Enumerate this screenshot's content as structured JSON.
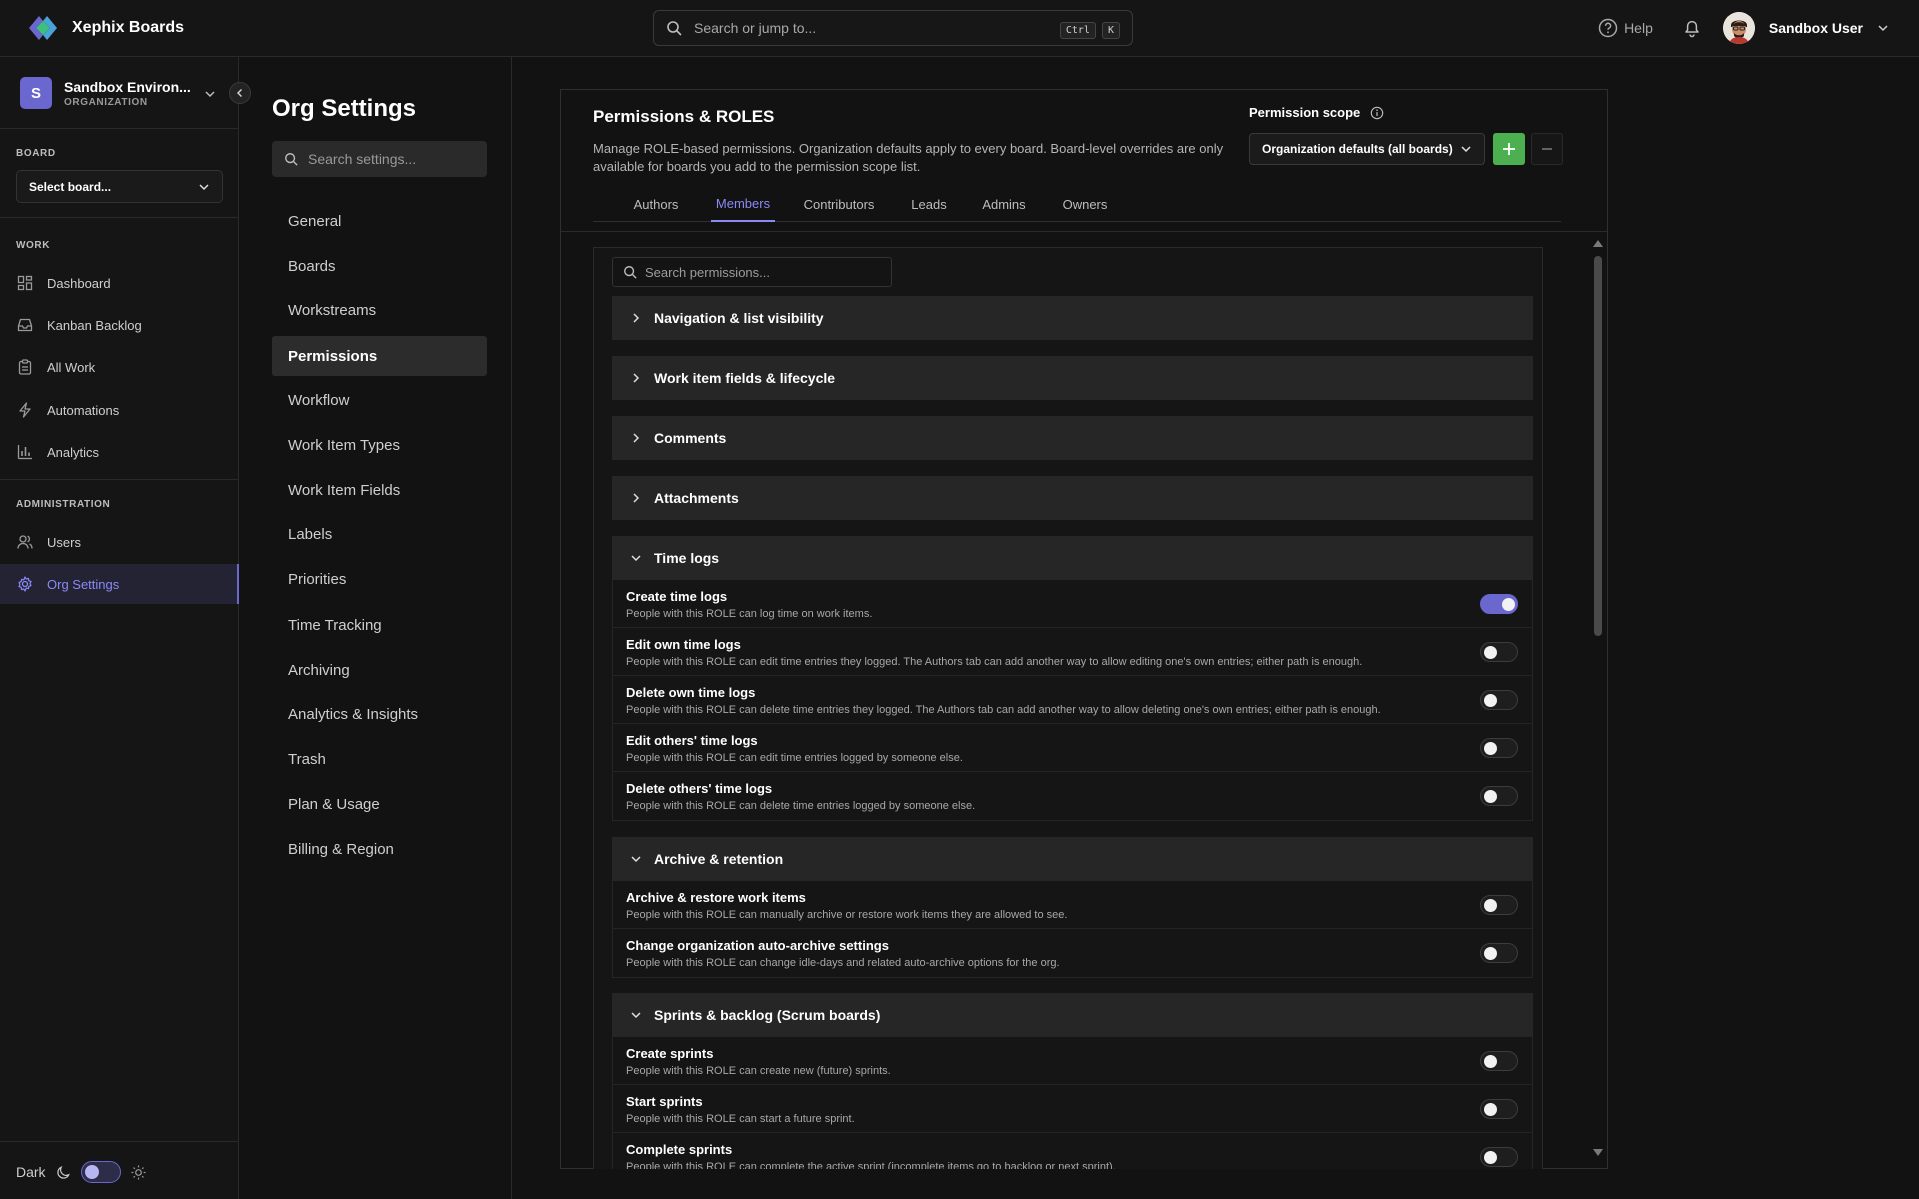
{
  "app": {
    "name": "Xephix Boards",
    "search_placeholder": "Search or jump to...",
    "shortcut_keys": [
      "Ctrl",
      "K"
    ],
    "help_label": "Help",
    "user_name": "Sandbox User"
  },
  "sidebar": {
    "org_initial": "S",
    "org_name": "Sandbox Environ...",
    "org_type": "ORGANIZATION",
    "board_label": "BOARD",
    "board_select": "Select board...",
    "work_label": "WORK",
    "work_items": [
      {
        "label": "Dashboard",
        "icon": "dashboard-icon"
      },
      {
        "label": "Kanban Backlog",
        "icon": "inbox-icon"
      },
      {
        "label": "All Work",
        "icon": "clipboard-icon"
      },
      {
        "label": "Automations",
        "icon": "lightning-icon"
      },
      {
        "label": "Analytics",
        "icon": "bar-chart-icon"
      }
    ],
    "admin_label": "ADMINISTRATION",
    "admin_items": [
      {
        "label": "Users",
        "icon": "users-icon"
      },
      {
        "label": "Org Settings",
        "icon": "gear-icon",
        "active": true
      }
    ],
    "theme_label": "Dark"
  },
  "settings": {
    "title": "Org Settings",
    "search_placeholder": "Search settings...",
    "items": [
      "General",
      "Boards",
      "Workstreams",
      "Permissions",
      "Workflow",
      "Work Item Types",
      "Work Item Fields",
      "Labels",
      "Priorities",
      "Time Tracking",
      "Archiving",
      "Analytics & Insights",
      "Trash",
      "Plan & Usage",
      "Billing & Region"
    ],
    "active_item": "Permissions"
  },
  "panel": {
    "title": "Permissions & ROLES",
    "description": "Manage ROLE-based permissions. Organization defaults apply to every board. Board-level overrides are only available for boards you add to the permission scope list.",
    "scope_label": "Permission scope",
    "scope_value": "Organization defaults (all boards)",
    "tabs": [
      "Authors",
      "Members",
      "Contributors",
      "Leads",
      "Admins",
      "Owners"
    ],
    "active_tab": "Members",
    "perm_search_placeholder": "Search permissions...",
    "collapsed_sections": [
      "Navigation & list visibility",
      "Work item fields & lifecycle",
      "Comments",
      "Attachments"
    ],
    "time_logs": {
      "title": "Time logs",
      "rows": [
        {
          "title": "Create time logs",
          "desc": "People with this ROLE can log time on work items.",
          "on": true
        },
        {
          "title": "Edit own time logs",
          "desc": "People with this ROLE can edit time entries they logged. The Authors tab can add another way to allow editing one's own entries; either path is enough.",
          "on": false
        },
        {
          "title": "Delete own time logs",
          "desc": "People with this ROLE can delete time entries they logged. The Authors tab can add another way to allow deleting one's own entries; either path is enough.",
          "on": false
        },
        {
          "title": "Edit others' time logs",
          "desc": "People with this ROLE can edit time entries logged by someone else.",
          "on": false
        },
        {
          "title": "Delete others' time logs",
          "desc": "People with this ROLE can delete time entries logged by someone else.",
          "on": false
        }
      ]
    },
    "archive": {
      "title": "Archive & retention",
      "rows": [
        {
          "title": "Archive & restore work items",
          "desc": "People with this ROLE can manually archive or restore work items they are allowed to see.",
          "on": false
        },
        {
          "title": "Change organization auto-archive settings",
          "desc": "People with this ROLE can change idle-days and related auto-archive options for the org.",
          "on": false
        }
      ]
    },
    "sprints": {
      "title": "Sprints & backlog (Scrum boards)",
      "rows": [
        {
          "title": "Create sprints",
          "desc": "People with this ROLE can create new (future) sprints.",
          "on": false
        },
        {
          "title": "Start sprints",
          "desc": "People with this ROLE can start a future sprint.",
          "on": false
        },
        {
          "title": "Complete sprints",
          "desc": "People with this ROLE can complete the active sprint (incomplete items go to backlog or next sprint).",
          "on": false
        }
      ]
    }
  },
  "colors": {
    "accent": "#6a67ce",
    "accent_text": "#8b89f5",
    "add_button": "#4caf50",
    "background": "#121212"
  }
}
